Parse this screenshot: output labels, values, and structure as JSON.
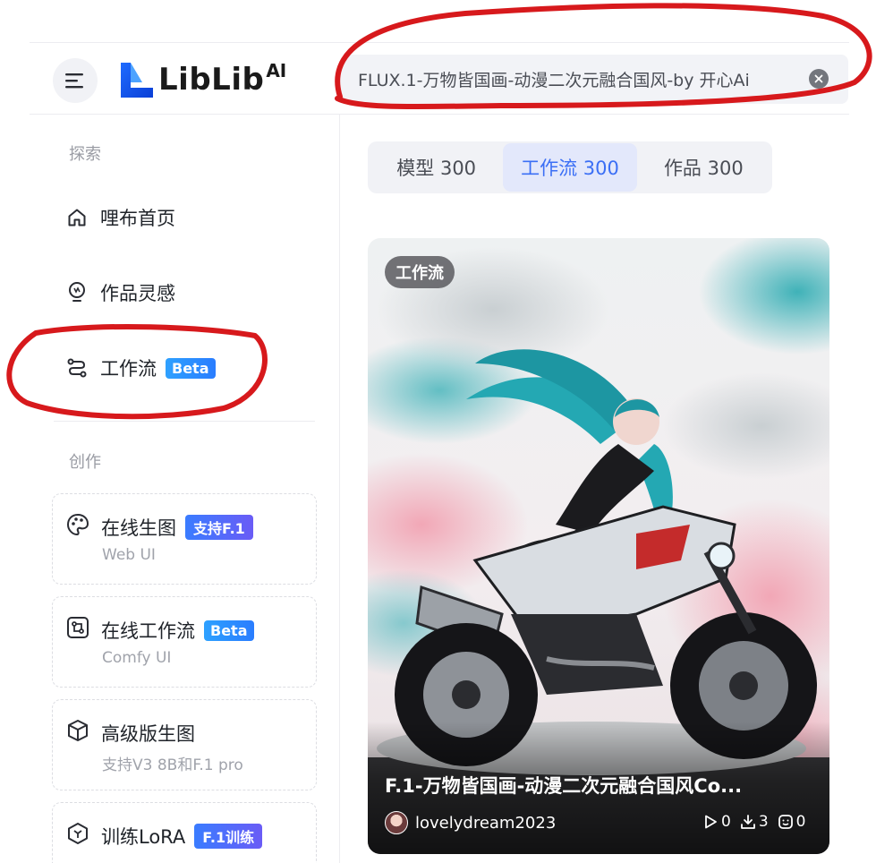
{
  "header": {
    "logo_text": "LibLib",
    "logo_suffix": "AI",
    "search_value": "FLUX.1-万物皆国画-动漫二次元融合国风-by 开心Ai"
  },
  "sidebar": {
    "explore_label": "探索",
    "nav": [
      {
        "label": "哩布首页",
        "icon": "home-icon"
      },
      {
        "label": "作品灵感",
        "icon": "lightbulb-icon"
      },
      {
        "label": "工作流",
        "icon": "workflow-icon",
        "badge": "Beta"
      }
    ],
    "create_label": "创作",
    "cards": [
      {
        "title": "在线生图",
        "badge": "支持F.1",
        "subtitle": "Web UI",
        "icon": "palette-icon"
      },
      {
        "title": "在线工作流",
        "badge": "Beta",
        "subtitle": "Comfy UI",
        "icon": "comfy-icon"
      },
      {
        "title": "高级版生图",
        "subtitle": "支持V3 8B和F.1 pro",
        "icon": "cube-icon"
      },
      {
        "title": "训练LoRA",
        "badge": "F.1训练",
        "icon": "hexagon-icon"
      }
    ]
  },
  "tabs": [
    {
      "label": "模型 300"
    },
    {
      "label": "工作流 300"
    },
    {
      "label": "作品 300"
    }
  ],
  "post": {
    "tag": "工作流",
    "title": "F.1-万物皆国画-动漫二次元融合国风Co...",
    "author": "lovelydream2023",
    "stats": {
      "runs": "0",
      "downloads": "3",
      "likes": "0"
    }
  },
  "colors": {
    "accent": "#3b6ff5",
    "annotation": "#d7191c",
    "beta": "#2a8cff"
  }
}
